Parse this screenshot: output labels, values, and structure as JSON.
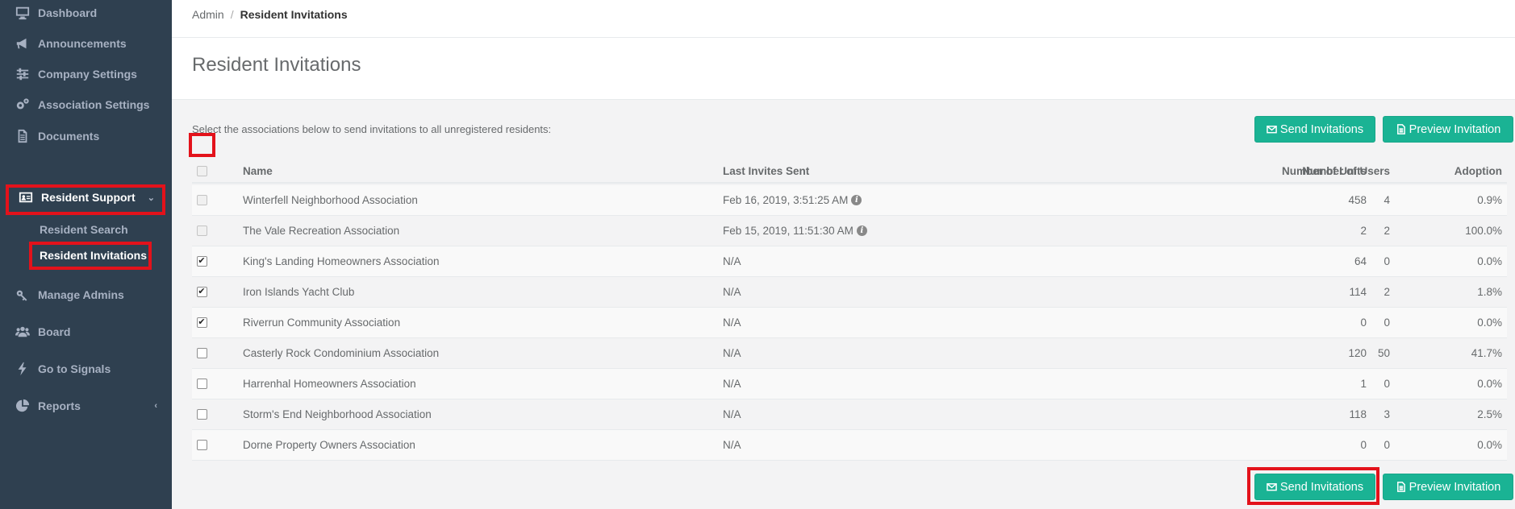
{
  "sidebar": {
    "items": [
      {
        "label": "Dashboard",
        "icon": "monitor-icon"
      },
      {
        "label": "Announcements",
        "icon": "bullhorn-icon"
      },
      {
        "label": "Company Settings",
        "icon": "sliders-icon"
      },
      {
        "label": "Association Settings",
        "icon": "gears-icon"
      },
      {
        "label": "Documents",
        "icon": "document-icon"
      },
      {
        "label": "Resident Support",
        "icon": "id-card-icon",
        "expanded": true
      },
      {
        "label": "Manage Admins",
        "icon": "key-icon"
      },
      {
        "label": "Board",
        "icon": "users-icon"
      },
      {
        "label": "Go to Signals",
        "icon": "bolt-icon"
      },
      {
        "label": "Reports",
        "icon": "pie-chart-icon"
      }
    ],
    "subitems": [
      {
        "label": "Resident Search"
      },
      {
        "label": "Resident Invitations",
        "active": true
      }
    ]
  },
  "breadcrumb": {
    "parent": "Admin",
    "separator": "/",
    "current": "Resident Invitations"
  },
  "page": {
    "title": "Resident Invitations",
    "instructions": "Select the associations below to send invitations to all unregistered residents:",
    "send_label": "Send Invitations",
    "preview_label": "Preview Invitation"
  },
  "table": {
    "headers": {
      "name": "Name",
      "last": "Last Invites Sent",
      "units": "Number of Units",
      "users": "Number of Users",
      "adoption": "Adoption"
    },
    "rows": [
      {
        "name": "Winterfell Neighborhood Association",
        "last": "Feb 16, 2019, 3:51:25 AM",
        "units": "458",
        "users": "4",
        "adoption": "0.9%",
        "checked": false,
        "disabled": true,
        "info": true
      },
      {
        "name": "The Vale Recreation Association",
        "last": "Feb 15, 2019, 11:51:30 AM",
        "units": "2",
        "users": "2",
        "adoption": "100.0%",
        "checked": false,
        "disabled": true,
        "info": true
      },
      {
        "name": "King's Landing Homeowners Association",
        "last": "N/A",
        "units": "64",
        "users": "0",
        "adoption": "0.0%",
        "checked": true,
        "disabled": false,
        "info": false
      },
      {
        "name": "Iron Islands Yacht Club",
        "last": "N/A",
        "units": "114",
        "users": "2",
        "adoption": "1.8%",
        "checked": true,
        "disabled": false,
        "info": false
      },
      {
        "name": "Riverrun Community Association",
        "last": "N/A",
        "units": "0",
        "users": "0",
        "adoption": "0.0%",
        "checked": true,
        "disabled": false,
        "info": false
      },
      {
        "name": "Casterly Rock Condominium Association",
        "last": "N/A",
        "units": "120",
        "users": "50",
        "adoption": "41.7%",
        "checked": false,
        "disabled": false,
        "info": false
      },
      {
        "name": "Harrenhal Homeowners Association",
        "last": "N/A",
        "units": "1",
        "users": "0",
        "adoption": "0.0%",
        "checked": false,
        "disabled": false,
        "info": false
      },
      {
        "name": "Storm's End Neighborhood Association",
        "last": "N/A",
        "units": "118",
        "users": "3",
        "adoption": "2.5%",
        "checked": false,
        "disabled": false,
        "info": false
      },
      {
        "name": "Dorne Property Owners Association",
        "last": "N/A",
        "units": "0",
        "users": "0",
        "adoption": "0.0%",
        "checked": false,
        "disabled": false,
        "info": false
      }
    ]
  },
  "colors": {
    "sidebar_bg": "#2f4050",
    "accent": "#1ab394",
    "highlight": "#e3121b"
  }
}
